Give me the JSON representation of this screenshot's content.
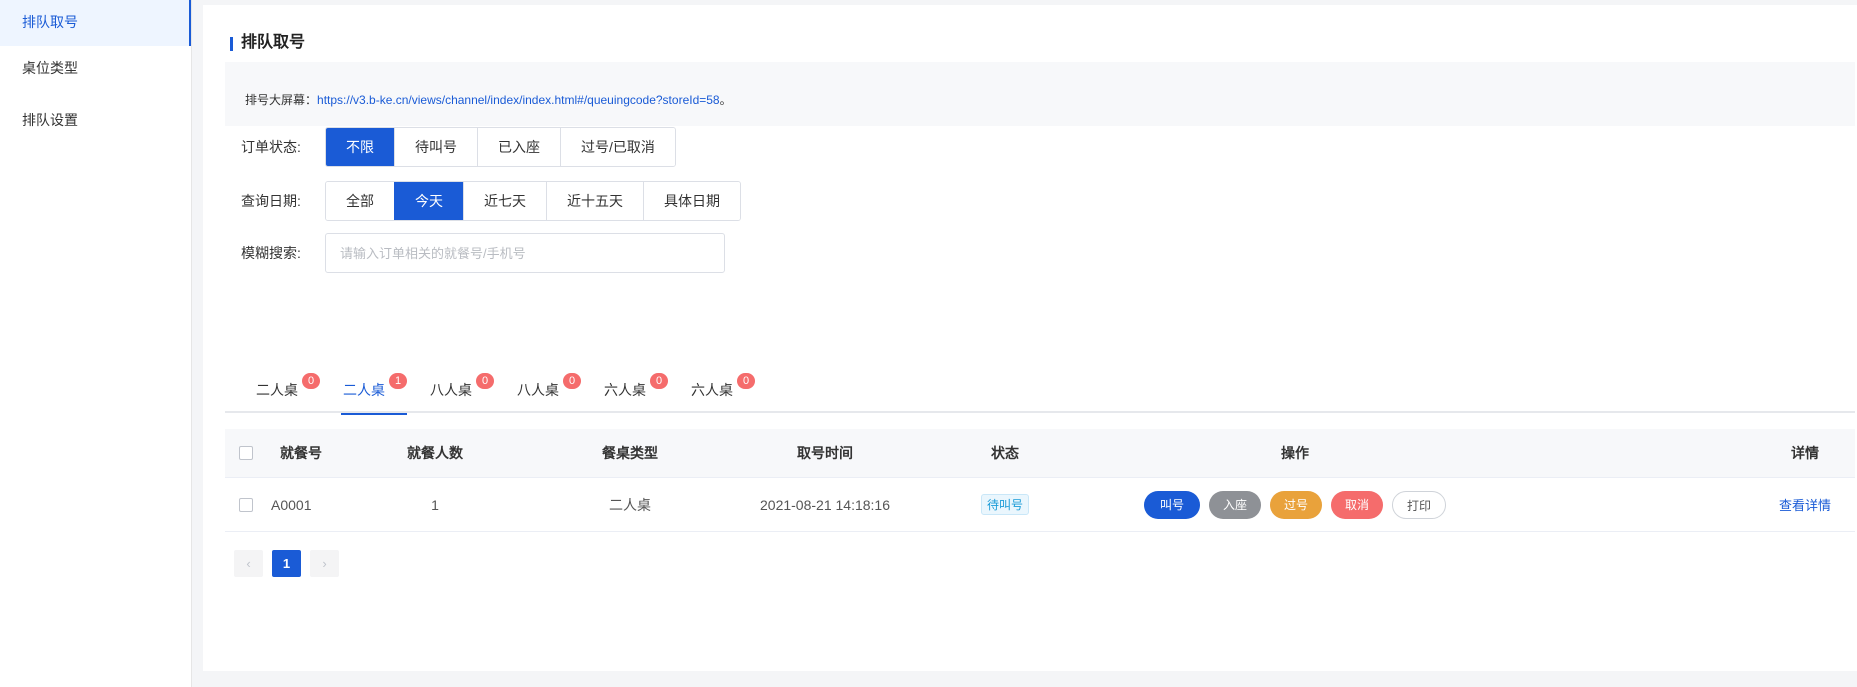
{
  "sidebar": {
    "items": [
      {
        "label": "排队取号",
        "active": true
      },
      {
        "label": "桌位类型",
        "active": false
      },
      {
        "label": "排队设置",
        "active": false
      }
    ]
  },
  "page": {
    "title": "排队取号",
    "notice_label": "排号大屏幕：",
    "notice_url": "https://v3.b-ke.cn/views/channel/index/index.html#/queuingcode?storeId=58",
    "notice_suffix": "。"
  },
  "filters": {
    "status_label": "订单状态:",
    "status_options": [
      "不限",
      "待叫号",
      "已入座",
      "过号/已取消"
    ],
    "status_selected": "不限",
    "date_label": "查询日期:",
    "date_options": [
      "全部",
      "今天",
      "近七天",
      "近十五天",
      "具体日期"
    ],
    "date_selected": "今天",
    "search_label": "模糊搜索:",
    "search_placeholder": "请输入订单相关的就餐号/手机号",
    "search_value": ""
  },
  "tabs": [
    {
      "label": "二人桌",
      "count": "0",
      "active": false
    },
    {
      "label": "二人桌",
      "count": "1",
      "active": true
    },
    {
      "label": "八人桌",
      "count": "0",
      "active": false
    },
    {
      "label": "八人桌",
      "count": "0",
      "active": false
    },
    {
      "label": "六人桌",
      "count": "0",
      "active": false
    },
    {
      "label": "六人桌",
      "count": "0",
      "active": false
    }
  ],
  "table": {
    "columns": [
      "就餐号",
      "就餐人数",
      "餐桌类型",
      "取号时间",
      "状态",
      "操作",
      "详情"
    ],
    "rows": [
      {
        "number": "A0001",
        "people": "1",
        "table_type": "二人桌",
        "time": "2021-08-21 14:18:16",
        "status": "待叫号",
        "actions": [
          "叫号",
          "入座",
          "过号",
          "取消",
          "打印"
        ],
        "detail": "查看详情"
      }
    ]
  },
  "pagination": {
    "current": "1",
    "prev_icon": "‹",
    "next_icon": "›"
  },
  "colors": {
    "primary": "#1a5bd6",
    "badge": "#f56c6c",
    "seat": "#8e9196",
    "skip": "#e9a23b",
    "cancel": "#f56c6c"
  }
}
